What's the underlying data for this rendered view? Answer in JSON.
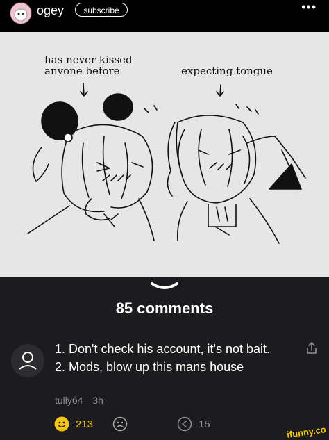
{
  "header": {
    "username": "ogey",
    "subscribe_label": "subscribe",
    "more_label": "•••"
  },
  "comic": {
    "caption_left_line1": "has never kissed",
    "caption_left_line2": "anyone before",
    "caption_right": "expecting tongue"
  },
  "comments": {
    "count_label": "85 comments",
    "items": [
      {
        "text": "1. Don't check his account, it's not bait. 2. Mods, blow up this mans house",
        "author": "tully64",
        "time": "3h",
        "upvotes": "213",
        "replies": "15"
      }
    ]
  },
  "watermark": "ifunny.co",
  "colors": {
    "background": "#1c1c1e",
    "header": "#000000",
    "accent": "#f5c518",
    "muted": "#8e8e93",
    "comic_bg": "#e6e6e6"
  }
}
